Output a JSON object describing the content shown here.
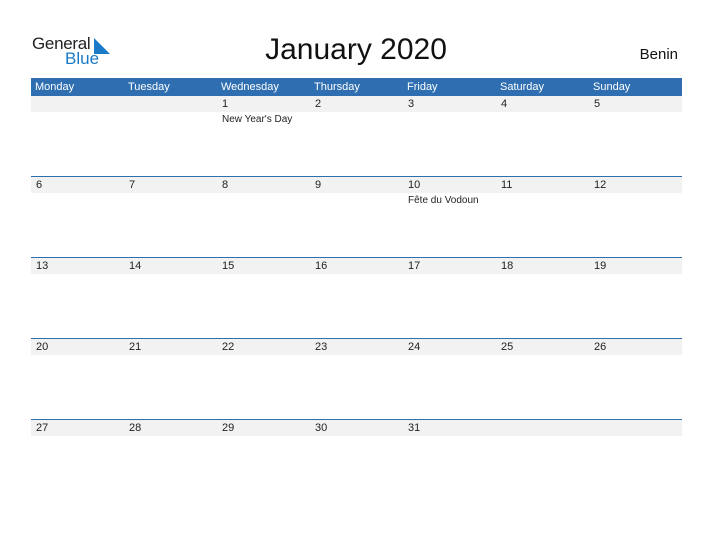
{
  "logo": {
    "general": "General",
    "blue": "Blue"
  },
  "title": "January 2020",
  "country": "Benin",
  "accent_color": "#2f6fb1",
  "weekdays": [
    "Monday",
    "Tuesday",
    "Wednesday",
    "Thursday",
    "Friday",
    "Saturday",
    "Sunday"
  ],
  "weeks": [
    [
      {
        "d": ""
      },
      {
        "d": ""
      },
      {
        "d": "1",
        "e": "New Year's Day"
      },
      {
        "d": "2"
      },
      {
        "d": "3"
      },
      {
        "d": "4"
      },
      {
        "d": "5"
      }
    ],
    [
      {
        "d": "6"
      },
      {
        "d": "7"
      },
      {
        "d": "8"
      },
      {
        "d": "9"
      },
      {
        "d": "10",
        "e": "Fête du Vodoun"
      },
      {
        "d": "11"
      },
      {
        "d": "12"
      }
    ],
    [
      {
        "d": "13"
      },
      {
        "d": "14"
      },
      {
        "d": "15"
      },
      {
        "d": "16"
      },
      {
        "d": "17"
      },
      {
        "d": "18"
      },
      {
        "d": "19"
      }
    ],
    [
      {
        "d": "20"
      },
      {
        "d": "21"
      },
      {
        "d": "22"
      },
      {
        "d": "23"
      },
      {
        "d": "24"
      },
      {
        "d": "25"
      },
      {
        "d": "26"
      }
    ],
    [
      {
        "d": "27"
      },
      {
        "d": "28"
      },
      {
        "d": "29"
      },
      {
        "d": "30"
      },
      {
        "d": "31"
      },
      {
        "d": ""
      },
      {
        "d": ""
      }
    ]
  ]
}
